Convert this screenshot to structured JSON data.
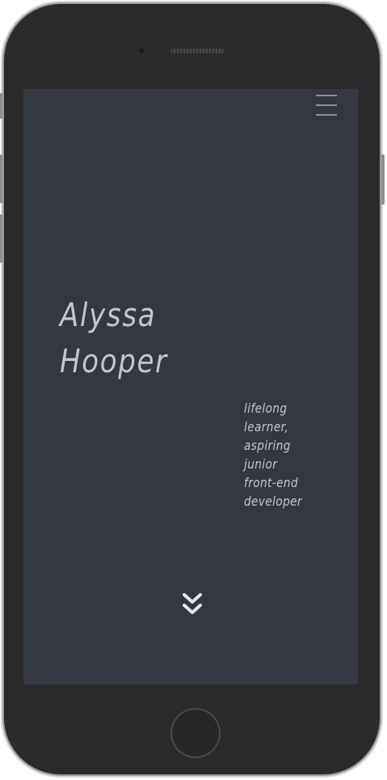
{
  "device": {
    "frame_color": "#2a2a2b",
    "screen_color": "#343843"
  },
  "header": {
    "menu_icon": "hamburger-menu-icon"
  },
  "hero": {
    "name_line1": "Alyssa",
    "name_line2": "Hooper",
    "tagline_lines": [
      "lifelong",
      "learner,",
      "aspiring",
      "junior",
      "front-end",
      "developer"
    ],
    "text_color": "#c4c6cc"
  },
  "scroll": {
    "icon": "double-chevron-down-icon"
  }
}
